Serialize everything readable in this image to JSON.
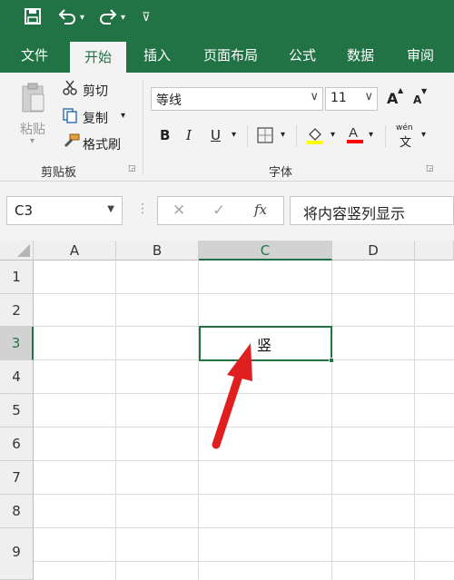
{
  "quick_access": {
    "save_icon": "save-icon",
    "undo_icon": "undo-icon",
    "redo_icon": "redo-icon",
    "customize_icon": "customize-qat-icon"
  },
  "tabs": [
    {
      "label": "文件"
    },
    {
      "label": "开始"
    },
    {
      "label": "插入"
    },
    {
      "label": "页面布局"
    },
    {
      "label": "公式"
    },
    {
      "label": "数据"
    },
    {
      "label": "审阅"
    }
  ],
  "clipboard": {
    "paste_label": "粘贴",
    "cut_label": "剪切",
    "copy_label": "复制",
    "format_painter_label": "格式刷",
    "group_label": "剪贴板"
  },
  "font": {
    "font_name": "等线",
    "font_size": "11",
    "bold": "B",
    "italic": "I",
    "underline": "U",
    "grow": "A",
    "shrink": "A",
    "phonetic": "wén",
    "group_label": "字体"
  },
  "formula_bar": {
    "name_box": "C3",
    "fx": "fx",
    "content": "将内容竖列显示"
  },
  "sheet": {
    "columns": [
      "A",
      "B",
      "C",
      "D"
    ],
    "rows": [
      "1",
      "2",
      "3",
      "4",
      "5",
      "6",
      "7",
      "8",
      "9"
    ],
    "active_cell_text": "竖"
  },
  "colors": {
    "accent": "#217346",
    "highlight": "#ffff00",
    "font_color": "#ff0000",
    "arrow": "#e02020"
  }
}
